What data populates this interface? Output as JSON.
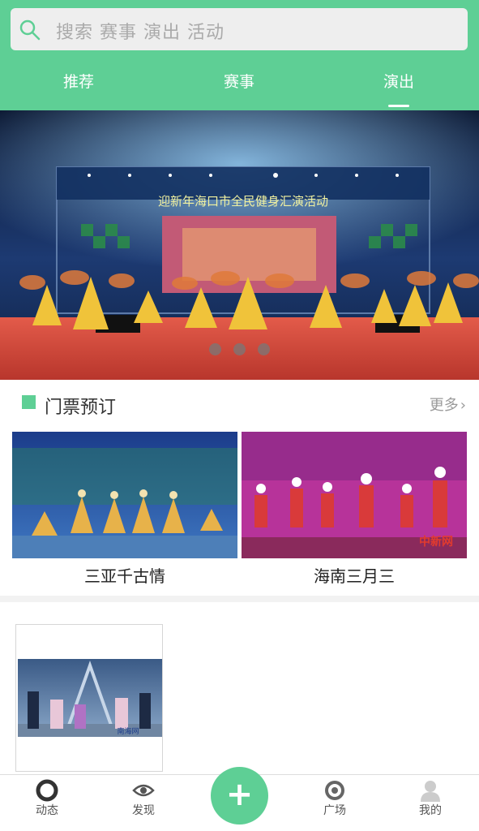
{
  "search": {
    "placeholder": "搜索 赛事 演出 活动"
  },
  "tabs": [
    {
      "label": "推荐",
      "active": false
    },
    {
      "label": "赛事",
      "active": false
    },
    {
      "label": "演出",
      "active": true
    }
  ],
  "banner": {
    "stage_text": "迎新年海口市全民健身汇演活动",
    "pager_dots": 3
  },
  "tickets": {
    "title": "门票预订",
    "more_label": "更多",
    "items": [
      {
        "label": "三亚千古情"
      },
      {
        "label": "海南三月三",
        "watermark": "中新网"
      }
    ]
  },
  "feed": {
    "items": [
      {
        "watermark": "南海网"
      }
    ]
  },
  "bottom_nav": [
    {
      "label": "动态",
      "icon": "ring-icon"
    },
    {
      "label": "发现",
      "icon": "eye-icon"
    },
    {
      "label": "",
      "icon": "plus-icon"
    },
    {
      "label": "广场",
      "icon": "target-icon"
    },
    {
      "label": "我的",
      "icon": "user-icon"
    }
  ],
  "colors": {
    "accent": "#5ecf95",
    "inactive_user": "#cccccc"
  }
}
